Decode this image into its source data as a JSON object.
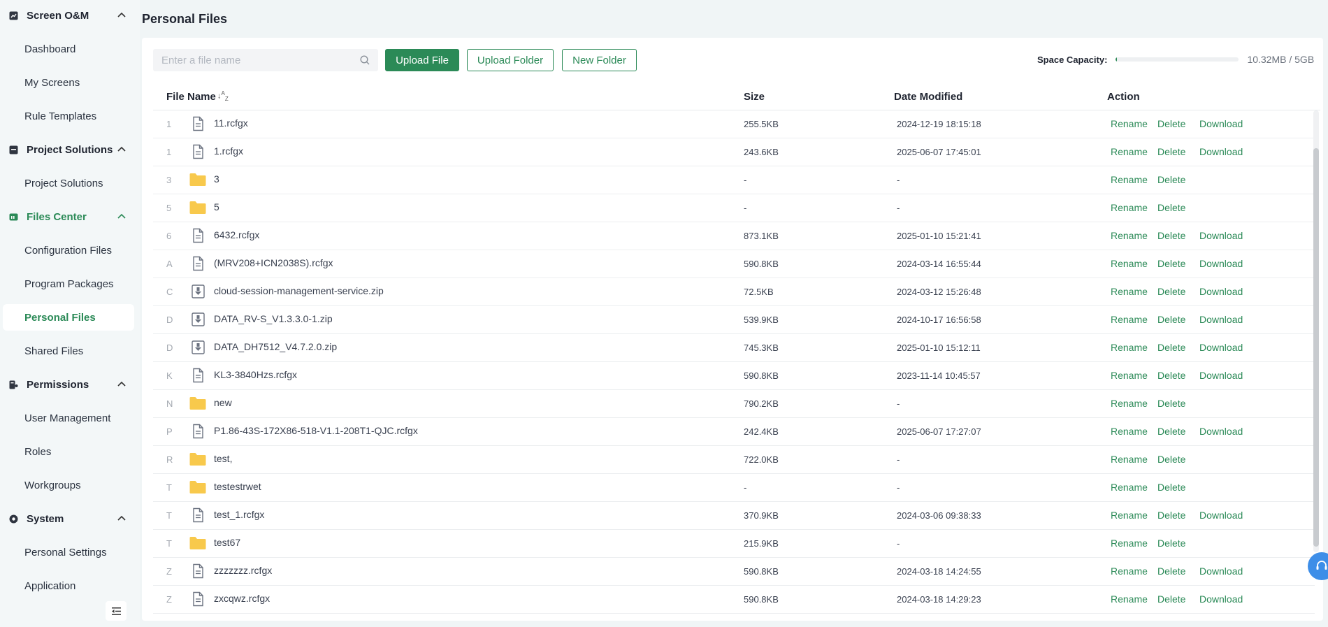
{
  "sidebar": {
    "groups": [
      {
        "label": "Screen O&M",
        "items": [
          {
            "label": "Dashboard"
          },
          {
            "label": "My Screens"
          },
          {
            "label": "Rule Templates"
          }
        ]
      },
      {
        "label": "Project Solutions",
        "items": [
          {
            "label": "Project Solutions"
          }
        ]
      },
      {
        "label": "Files Center",
        "items": [
          {
            "label": "Configuration Files"
          },
          {
            "label": "Program Packages"
          },
          {
            "label": "Personal Files"
          },
          {
            "label": "Shared Files"
          }
        ]
      },
      {
        "label": "Permissions",
        "items": [
          {
            "label": "User Management"
          },
          {
            "label": "Roles"
          },
          {
            "label": "Workgroups"
          }
        ]
      },
      {
        "label": "System",
        "items": [
          {
            "label": "Personal Settings"
          },
          {
            "label": "Application"
          }
        ]
      }
    ]
  },
  "page": {
    "title": "Personal Files"
  },
  "toolbar": {
    "search_placeholder": "Enter a file name",
    "upload_file": "Upload File",
    "upload_folder": "Upload Folder",
    "new_folder": "New Folder"
  },
  "capacity": {
    "label": "Space Capacity:",
    "value": "10.32MB / 5GB",
    "used_fraction": 0.002
  },
  "colors": {
    "accent": "#2b8a57",
    "folder": "#f8c94c",
    "support": "#3d8ee8"
  },
  "table": {
    "headers": {
      "name": "File Name",
      "size": "Size",
      "date": "Date Modified",
      "action": "Action"
    },
    "actions": {
      "rename": "Rename",
      "delete": "Delete",
      "download": "Download"
    },
    "rows": [
      {
        "idx": "1",
        "type": "file",
        "name": "11.rcfgx",
        "size": "255.5KB",
        "date": "2024-12-19 18:15:18"
      },
      {
        "idx": "1",
        "type": "file",
        "name": "1.rcfgx",
        "size": "243.6KB",
        "date": "2025-06-07 17:45:01"
      },
      {
        "idx": "3",
        "type": "folder",
        "name": "3",
        "size": "-",
        "date": "-"
      },
      {
        "idx": "5",
        "type": "folder",
        "name": "5",
        "size": "-",
        "date": "-"
      },
      {
        "idx": "6",
        "type": "file",
        "name": "6432.rcfgx",
        "size": "873.1KB",
        "date": "2025-01-10 15:21:41"
      },
      {
        "idx": "A",
        "type": "file",
        "name": "(MRV208+ICN2038S).rcfgx",
        "size": "590.8KB",
        "date": "2024-03-14 16:55:44"
      },
      {
        "idx": "C",
        "type": "zip",
        "name": "cloud-session-management-service.zip",
        "size": "72.5KB",
        "date": "2024-03-12 15:26:48"
      },
      {
        "idx": "D",
        "type": "zip",
        "name": "DATA_RV-S_V1.3.3.0-1.zip",
        "size": "539.9KB",
        "date": "2024-10-17 16:56:58"
      },
      {
        "idx": "D",
        "type": "zip",
        "name": "DATA_DH7512_V4.7.2.0.zip",
        "size": "745.3KB",
        "date": "2025-01-10 15:12:11"
      },
      {
        "idx": "K",
        "type": "file",
        "name": "KL3-3840Hzs.rcfgx",
        "size": "590.8KB",
        "date": "2023-11-14 10:45:57"
      },
      {
        "idx": "N",
        "type": "folder",
        "name": "new",
        "size": "790.2KB",
        "date": "-"
      },
      {
        "idx": "P",
        "type": "file",
        "name": "P1.86-43S-172X86-518-V1.1-208T1-QJC.rcfgx",
        "size": "242.4KB",
        "date": "2025-06-07 17:27:07"
      },
      {
        "idx": "R",
        "type": "folder",
        "name": "test,",
        "size": "722.0KB",
        "date": "-"
      },
      {
        "idx": "T",
        "type": "folder",
        "name": "testestrwet",
        "size": "-",
        "date": "-"
      },
      {
        "idx": "T",
        "type": "file",
        "name": "test_1.rcfgx",
        "size": "370.9KB",
        "date": "2024-03-06 09:38:33"
      },
      {
        "idx": "T",
        "type": "folder",
        "name": "test67",
        "size": "215.9KB",
        "date": "-"
      },
      {
        "idx": "Z",
        "type": "file",
        "name": "zzzzzzz.rcfgx",
        "size": "590.8KB",
        "date": "2024-03-18 14:24:55"
      },
      {
        "idx": "Z",
        "type": "file",
        "name": "zxcqwz.rcfgx",
        "size": "590.8KB",
        "date": "2024-03-18 14:29:23"
      }
    ]
  }
}
